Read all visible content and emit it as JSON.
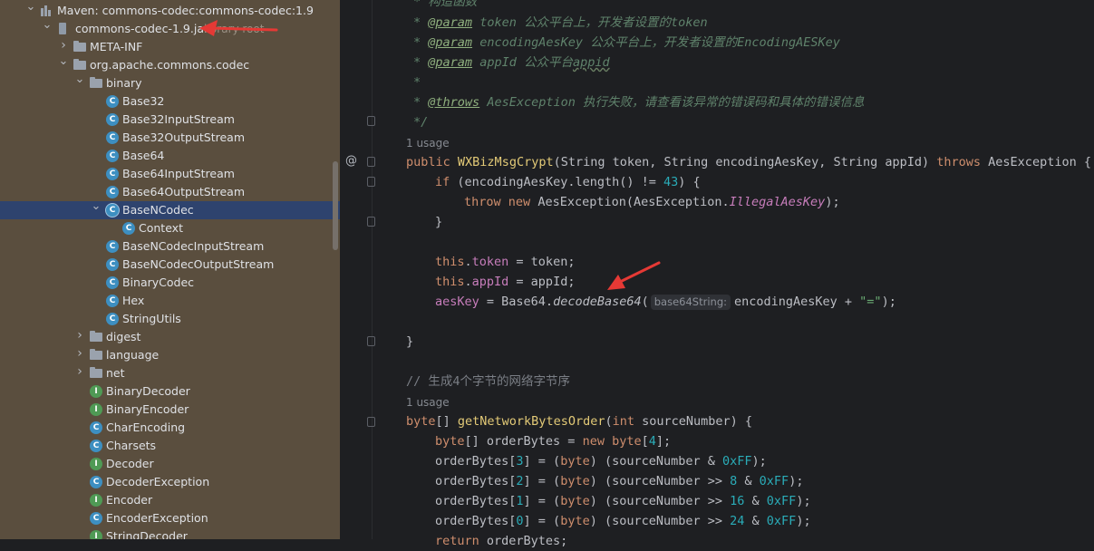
{
  "tree": {
    "rows": [
      {
        "label": "Maven: commons-codec:commons-codec:1.9",
        "icon": "library-icon",
        "indent": 0,
        "expanded": true
      },
      {
        "label": "commons-codec-1.9.jar",
        "suffix": "library root",
        "icon": "jar-icon",
        "indent": 1,
        "expanded": true
      },
      {
        "label": "META-INF",
        "icon": "folder-icon",
        "indent": 2,
        "expanded": false
      },
      {
        "label": "org.apache.commons.codec",
        "icon": "folder-icon",
        "indent": 2,
        "expanded": true
      },
      {
        "label": "binary",
        "icon": "folder-icon",
        "indent": 3,
        "expanded": true
      },
      {
        "label": "Base32",
        "icon": "class-icon",
        "indent": 4
      },
      {
        "label": "Base32InputStream",
        "icon": "class-icon",
        "indent": 4
      },
      {
        "label": "Base32OutputStream",
        "icon": "class-icon",
        "indent": 4
      },
      {
        "label": "Base64",
        "icon": "class-icon",
        "indent": 4
      },
      {
        "label": "Base64InputStream",
        "icon": "class-icon",
        "indent": 4
      },
      {
        "label": "Base64OutputStream",
        "icon": "class-icon",
        "indent": 4
      },
      {
        "label": "BaseNCodec",
        "icon": "abstract-class-icon",
        "indent": 4,
        "expanded": true,
        "selected": true
      },
      {
        "label": "Context",
        "icon": "inner-class-icon",
        "indent": 5
      },
      {
        "label": "BaseNCodecInputStream",
        "icon": "class-icon",
        "indent": 4
      },
      {
        "label": "BaseNCodecOutputStream",
        "icon": "class-icon",
        "indent": 4
      },
      {
        "label": "BinaryCodec",
        "icon": "class-icon",
        "indent": 4
      },
      {
        "label": "Hex",
        "icon": "class-icon",
        "indent": 4
      },
      {
        "label": "StringUtils",
        "icon": "class-icon",
        "indent": 4
      },
      {
        "label": "digest",
        "icon": "folder-icon",
        "indent": 3,
        "expanded": false
      },
      {
        "label": "language",
        "icon": "folder-icon",
        "indent": 3,
        "expanded": false
      },
      {
        "label": "net",
        "icon": "folder-icon",
        "indent": 3,
        "expanded": false
      },
      {
        "label": "BinaryDecoder",
        "icon": "interface-icon",
        "indent": 3
      },
      {
        "label": "BinaryEncoder",
        "icon": "interface-icon",
        "indent": 3
      },
      {
        "label": "CharEncoding",
        "icon": "class-icon",
        "indent": 3
      },
      {
        "label": "Charsets",
        "icon": "class-icon",
        "indent": 3
      },
      {
        "label": "Decoder",
        "icon": "interface-icon",
        "indent": 3
      },
      {
        "label": "DecoderException",
        "icon": "class-icon",
        "indent": 3
      },
      {
        "label": "Encoder",
        "icon": "interface-icon",
        "indent": 3
      },
      {
        "label": "EncoderException",
        "icon": "class-icon",
        "indent": 3
      },
      {
        "label": "StringDecoder",
        "icon": "interface-icon",
        "indent": 3
      }
    ]
  },
  "editor": {
    "doc": {
      "l1": "* 构造函数",
      "tag_param": "@param",
      "tag_throws": "@throws",
      "p1_name": "token",
      "p1_desc": "公众平台上，开发者设置的token",
      "p2_name": "encodingAesKey",
      "p2_desc": "公众平台上，开发者设置的EncodingAESKey",
      "p3_name": "appId",
      "p3_desc": "公众平台",
      "p3_desc2": "appid",
      "throws_name": "AesException",
      "throws_desc": "执行失败，请查看该异常的错误码和具体的错误信息",
      "star": "*",
      "close": "*/"
    },
    "usage1": "1 usage",
    "usage2": "1 usage",
    "ctor": {
      "public": "public",
      "name": "WXBizMsgCrypt",
      "params": "(String token, String encodingAesKey, String appId)",
      "throws": "throws",
      "exc": "AesException {"
    },
    "if_line": {
      "kw": "if",
      "pre": "(encodingAesKey.length() != ",
      "num": "43",
      "post": ") {"
    },
    "throw_line": {
      "kw1": "throw",
      "kw2": "new",
      "pre": "AesException(AesException.",
      "const": "IllegalAesKey",
      "post": ");"
    },
    "brace": "}",
    "this_token": {
      "kw": "this",
      "dot": ".",
      "fld": "token",
      "rest": " = token;"
    },
    "this_appid": {
      "kw": "this",
      "dot": ".",
      "fld": "appId",
      "rest": " = appId;"
    },
    "aeskey": {
      "fld": "aesKey",
      "eq": " = Base64.",
      "call": "decodeBase64",
      "paren": "(",
      "hint": "base64String:",
      "arg": "encodingAesKey + ",
      "str": "\"=\"",
      "end": ");"
    },
    "close_brace": "}",
    "comment": "// 生成4个字节的网络字节序",
    "method": {
      "type_kw": "byte",
      "type_rest": "[] ",
      "name": "getNetworkBytesOrder",
      "open": "(",
      "arg_kw": "int",
      "arg_rest": " sourceNumber) {"
    },
    "alloc": {
      "kw": "byte",
      "mid": "[] orderBytes = ",
      "kw2": "new",
      "kw3": "byte",
      "open": "[",
      "num": "4",
      "close": "];"
    },
    "assigns": [
      {
        "idx": "3",
        "shift": "",
        "mask": "0xFF"
      },
      {
        "idx": "2",
        "shift": "8",
        "mask": "0xFF"
      },
      {
        "idx": "1",
        "shift": "16",
        "mask": "0xFF"
      },
      {
        "idx": "0",
        "shift": "24",
        "mask": "0xFF"
      }
    ],
    "ret": "return orderBytes;"
  },
  "gutter": {
    "at_mark": "@"
  },
  "colors": {
    "tree_bg": "#5a4e3e",
    "editor_bg": "#1e1f22",
    "selection": "#2e436e",
    "arrow": "#e53935"
  }
}
